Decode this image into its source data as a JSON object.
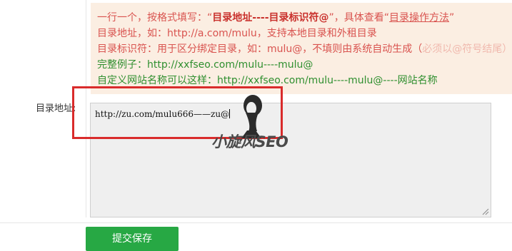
{
  "notice": {
    "line1_prefix": "一行一个，按格式填写：“",
    "line1_bold": "目录地址----目录标识符@",
    "line1_mid": "”，具体查看“",
    "line1_link": "目录操作方法",
    "line1_suffix": "”",
    "line2": "目录地址，如：http://a.com/mulu，支持本地目录和外租目录",
    "line3_main": "目录标识符：用于区分绑定目录，如：mulu@，不填则由系统自动生成（",
    "line3_faint": "必须以@符号结尾",
    "line3_end": "）",
    "line4": "完整例子：http://xxfseo.com/mulu----mulu@",
    "line5": "自定义网站名称可以这样：http://xxfseo.com/mulu----mulu@----网站名称"
  },
  "form": {
    "directory_label": "目录地址:",
    "directory_value": "http://zu.com/mulu666——zu@"
  },
  "watermark": {
    "text": "小旋风SEO"
  },
  "actions": {
    "submit_label": "提交保存"
  },
  "colors": {
    "notice_bg": "#fbeee2",
    "notice_text": "#d9534f",
    "highlight_border": "#d92b2b",
    "submit_bg": "#27a844"
  }
}
